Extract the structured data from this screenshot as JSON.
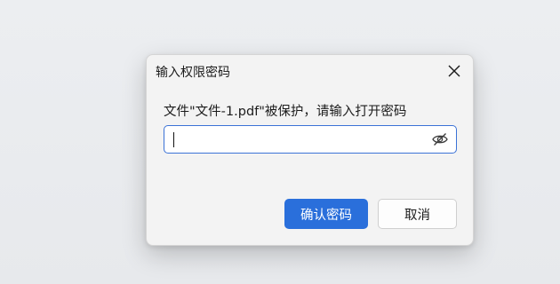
{
  "dialog": {
    "title": "输入权限密码",
    "message": "文件\"文件-1.pdf\"被保护，请输入打开密码",
    "password": {
      "value": "",
      "placeholder": ""
    },
    "confirm_label": "确认密码",
    "cancel_label": "取消",
    "close_icon": "close-icon",
    "visibility_icon": "eye-off-icon"
  },
  "colors": {
    "accent": "#2a6fdb",
    "input_border": "#3b72d6",
    "dialog_bg": "#f3f3f3"
  }
}
